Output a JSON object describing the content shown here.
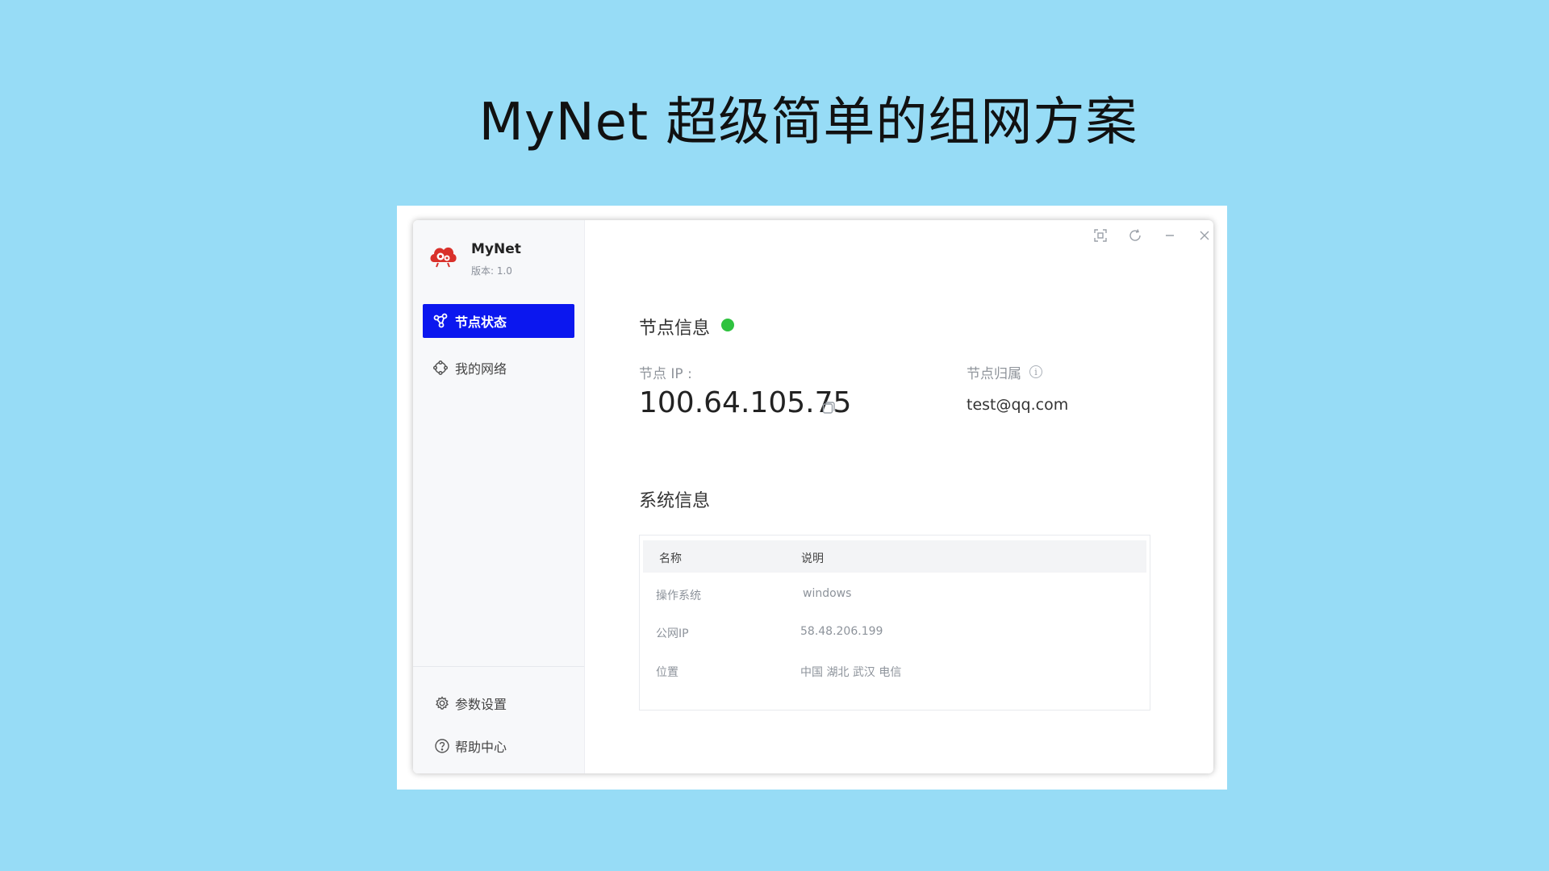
{
  "slide": {
    "title": "MyNet 超级简单的组网方案"
  },
  "app": {
    "name": "MyNet",
    "version": "版本: 1.0"
  },
  "sidebar": {
    "items": [
      {
        "label": "节点状态",
        "icon": "share-nodes-icon",
        "active": true
      },
      {
        "label": "我的网络",
        "icon": "network-ring-icon",
        "active": false
      }
    ],
    "bottom": [
      {
        "label": "参数设置",
        "icon": "gear-icon"
      },
      {
        "label": "帮助中心",
        "icon": "help-circle-icon"
      }
    ]
  },
  "window_controls": [
    "scan-icon",
    "refresh-icon",
    "minimize-icon",
    "close-icon"
  ],
  "node": {
    "section_title": "节点信息",
    "status_color": "#2fc23f",
    "ip_label": "节点 IP :",
    "ip_value": "100.64.105.75",
    "owner_label": "节点归属",
    "owner_value": "test@qq.com"
  },
  "system": {
    "section_title": "系统信息",
    "columns": [
      "名称",
      "说明"
    ],
    "rows": [
      {
        "name": "操作系统",
        "desc": "windows"
      },
      {
        "name": "公网IP",
        "desc": "58.48.206.199"
      },
      {
        "name": "位置",
        "desc": "中国 湖北 武汉  电信"
      }
    ]
  },
  "colors": {
    "accent": "#0b17ef",
    "background": "#97dcf6",
    "status_online": "#2fc23f"
  }
}
